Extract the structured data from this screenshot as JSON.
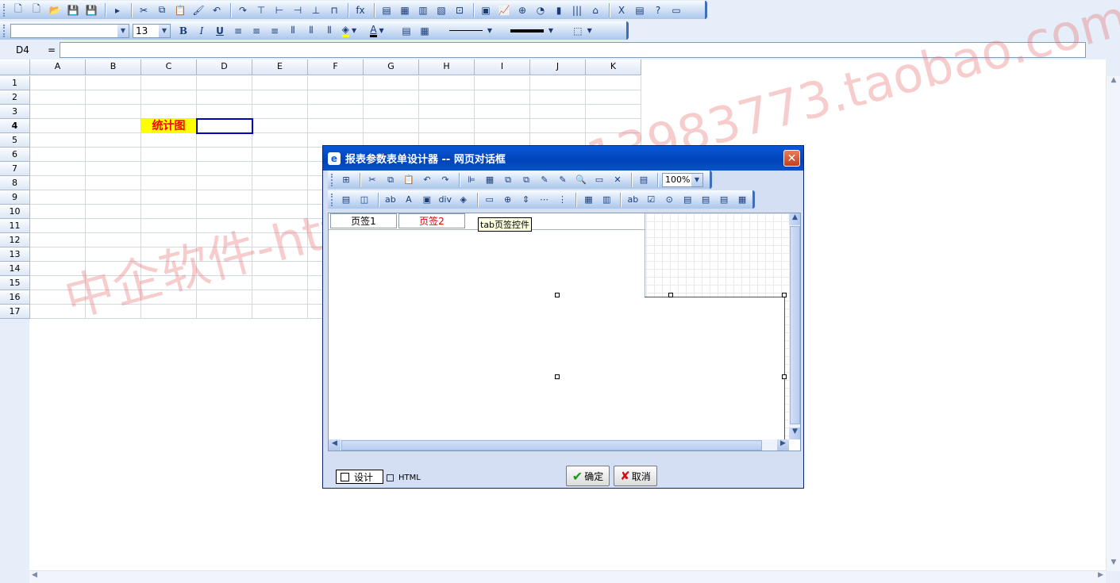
{
  "toolbar1": {
    "icons": [
      "new-icon",
      "new-blank-icon",
      "open-folder-icon",
      "save-icon",
      "save-as-icon",
      "play-icon",
      "cut-icon",
      "copy-icon",
      "paste-icon",
      "format-painter-icon",
      "undo-icon",
      "redo-icon",
      "insert-row-icon",
      "insert-col-icon",
      "delete-row-icon",
      "delete-col-icon",
      "merge-icon",
      "function-icon",
      "chart-icon",
      "report-icon",
      "form-icon",
      "table-icon",
      "insert-object-icon",
      "image-icon",
      "line-chart-icon",
      "zoom-icon",
      "pie-icon",
      "bar-chart-icon",
      "barcode-icon",
      "house-icon",
      "excel-icon",
      "print-icon",
      "help-icon",
      "dialog-icon"
    ],
    "glyphs": [
      "🗋",
      "🗋",
      "📂",
      "💾",
      "💾",
      "▸",
      "✂",
      "⧉",
      "📋",
      "🖌",
      "↶",
      "↷",
      "⊤",
      "⊢",
      "⊣",
      "⊥",
      "⊓",
      "fx",
      "▤",
      "▦",
      "▥",
      "▧",
      "⊡",
      "▣",
      "📈",
      "⊕",
      "◔",
      "▮",
      "|||",
      "⌂",
      "X",
      "▤",
      "?",
      "▭"
    ]
  },
  "toolbar2": {
    "font_name": "",
    "font_size": "13",
    "bold": "B",
    "italic": "I",
    "underline": "U",
    "font_color_letter": "A",
    "colors": {
      "fill": "#ffff00",
      "font": "#000000"
    }
  },
  "formula_bar": {
    "cell_ref": "D4",
    "equals": "=",
    "value": ""
  },
  "sheet": {
    "columns": [
      "A",
      "B",
      "C",
      "D",
      "E",
      "F",
      "G",
      "H",
      "I",
      "J",
      "K"
    ],
    "rows": [
      "1",
      "2",
      "3",
      "4",
      "5",
      "6",
      "7",
      "8",
      "9",
      "10",
      "11",
      "12",
      "13",
      "14",
      "15",
      "16",
      "17"
    ],
    "selected_cell": "D4",
    "cell_c4": "统计图",
    "colors": {
      "c4_bg": "#ffff00",
      "c4_fg": "#ff0000",
      "selection": "#0000c0"
    }
  },
  "watermark": "中企软件-https://shop113983773.taobao.com",
  "dialog": {
    "title": "报表参数表单设计器 -- 网页对话框",
    "close": "✕",
    "zoom": "100%",
    "toolbar_a_glyphs": [
      "⊞",
      "✂",
      "⧉",
      "📋",
      "↶",
      "↷",
      "⊫",
      "▦",
      "⧉",
      "⧉",
      "✎",
      "✎",
      "🔍",
      "▭",
      "✕",
      "▤"
    ],
    "toolbar_a_icons": [
      "properties-icon",
      "cut-icon",
      "copy-icon",
      "paste-icon",
      "undo-icon",
      "redo-icon",
      "align-left-icon",
      "align-center-icon",
      "bring-front-icon",
      "send-back-icon",
      "edit-icon",
      "edit-form-icon",
      "preview-icon",
      "comment-icon",
      "tools-icon",
      "list-icon"
    ],
    "toolbar_b_glyphs": [
      "▤",
      "◫",
      "ab",
      "A",
      "▣",
      "div",
      "◈",
      "▭",
      "⊕",
      "⇕",
      "⋯",
      "⋮",
      "▦",
      "▥",
      "ab",
      "☑",
      "⊙",
      "▤",
      "▤",
      "▤",
      "▦"
    ],
    "toolbar_b_icons": [
      "grid-icon",
      "image-icon",
      "textbox-icon",
      "label-icon",
      "picture-icon",
      "div-icon",
      "shape-icon",
      "tab-icon",
      "globe-icon",
      "vspace-icon",
      "hspace-icon",
      "vlist-icon",
      "table-icon",
      "column-icon",
      "input-icon",
      "checkbox-icon",
      "radio-icon",
      "listbox-icon",
      "combo-icon",
      "select-icon",
      "calendar-icon"
    ],
    "tabs": [
      "页签1",
      "页签2"
    ],
    "tooltip": "tab页签控件",
    "mode_design": "设计",
    "mode_html": "HTML",
    "ok": "确定",
    "cancel": "取消"
  }
}
